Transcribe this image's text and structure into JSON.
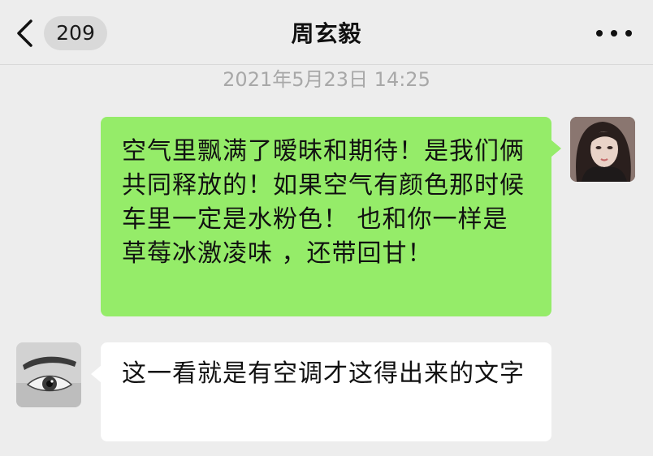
{
  "header": {
    "back_icon": "chevron-left-icon",
    "unread_count": "209",
    "title": "周玄毅",
    "more_icon": "more-dots-icon"
  },
  "timestamp": "2021年5月23日 14:25",
  "messages": [
    {
      "side": "right",
      "bubble_color": "#95ec69",
      "avatar": "avatar-woman-photo",
      "text": "空气里飘满了暧昧和期待！是我们俩共同释放的！如果空气有颜色那时候车里一定是水粉色！ 也和你一样是草莓冰激凌味 ，还带回甘！"
    },
    {
      "side": "left",
      "bubble_color": "#ffffff",
      "avatar": "avatar-eye-photo",
      "text": "这一看就是有空调才这得出来的文字"
    }
  ],
  "colors": {
    "background": "#ededed",
    "accent_green": "#95ec69",
    "timestamp_gray": "#a8a8a8"
  }
}
